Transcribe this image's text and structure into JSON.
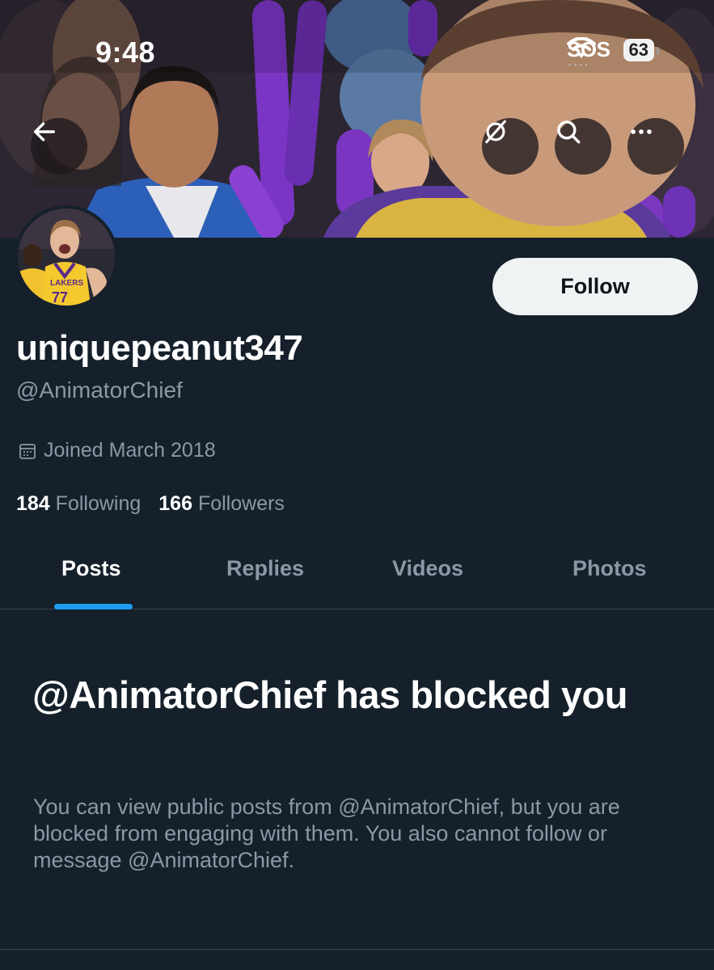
{
  "status_bar": {
    "time": "9:48",
    "sos": "SOS",
    "battery": "63"
  },
  "header": {
    "back_icon": "arrow-left-icon",
    "grok_icon": "grok-icon",
    "search_icon": "search-icon",
    "more_icon": "more-horizontal-icon"
  },
  "profile": {
    "display_name": "uniquepeanut347",
    "handle": "@AnimatorChief",
    "joined": "Joined March 2018",
    "following_count": "184",
    "following_label": "Following",
    "followers_count": "166",
    "followers_label": "Followers",
    "follow_label": "Follow"
  },
  "tabs": [
    {
      "label": "Posts",
      "active": true
    },
    {
      "label": "Replies",
      "active": false
    },
    {
      "label": "Videos",
      "active": false
    },
    {
      "label": "Photos",
      "active": false
    }
  ],
  "blocked": {
    "title": "@AnimatorChief has blocked you",
    "body": "You can view public posts from @AnimatorChief, but you are blocked from engaging with them. You also cannot follow or message @AnimatorChief."
  },
  "colors": {
    "background": "#15202b",
    "accent": "#1d9bf0",
    "secondary_text": "#8b98a5",
    "follow_button": "#eff3f4"
  }
}
